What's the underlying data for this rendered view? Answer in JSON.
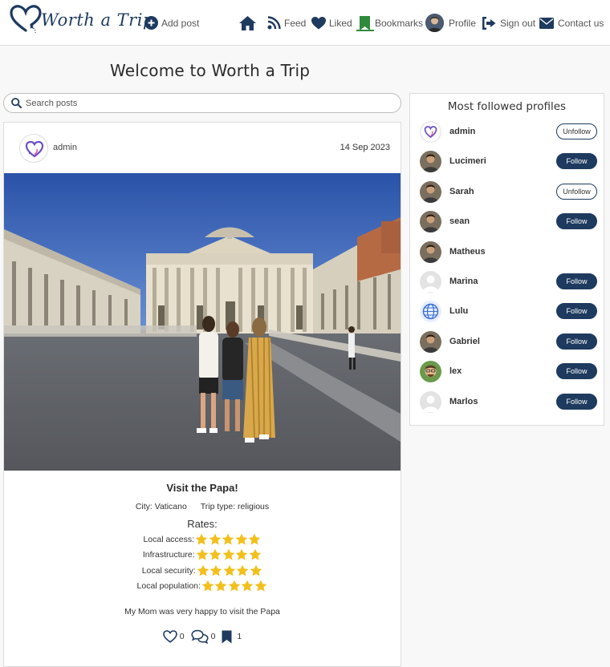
{
  "nav": {
    "logo_text": "Worth a Trip",
    "add_post": "Add post",
    "feed": "Feed",
    "liked": "Liked",
    "bookmarks": "Bookmarks",
    "profile": "Profile",
    "sign_out": "Sign out",
    "contact": "Contact us",
    "brand_color": "#1e3a5f",
    "active_color": "#2f8a3d"
  },
  "page": {
    "title": "Welcome to Worth a Trip"
  },
  "search": {
    "placeholder": "Search posts"
  },
  "post": {
    "owner": "admin",
    "date": "14 Sep 2023",
    "title": "Visit the Papa!",
    "city": "City: Vaticano",
    "trip_type": "Trip type: religious",
    "rates_title": "Rates:",
    "rates": [
      {
        "label": "Local access:",
        "stars": 5
      },
      {
        "label": "Infrastructure:",
        "stars": 5
      },
      {
        "label": "Local security:",
        "stars": 5
      },
      {
        "label": "Local population:",
        "stars": 5
      }
    ],
    "content": "My Mom was very happy to visit the Papa",
    "likes_count": "0",
    "comments_count": "0",
    "bookmarks_count": "1"
  },
  "profiles": {
    "title": "Most followed profiles",
    "items": [
      {
        "name": "admin",
        "button": "Unfollow",
        "avatar": "logo-heart"
      },
      {
        "name": "Lucimeri",
        "button": "Follow",
        "avatar": "photo"
      },
      {
        "name": "Sarah",
        "button": "Unfollow",
        "avatar": "photo"
      },
      {
        "name": "sean",
        "button": "Follow",
        "avatar": "photo"
      },
      {
        "name": "Matheus",
        "button": "",
        "avatar": "photo"
      },
      {
        "name": "Marina",
        "button": "Follow",
        "avatar": "default-user"
      },
      {
        "name": "Lulu",
        "button": "Follow",
        "avatar": "globe"
      },
      {
        "name": "Gabriel",
        "button": "Follow",
        "avatar": "photo"
      },
      {
        "name": "lex",
        "button": "Follow",
        "avatar": "cartoon"
      },
      {
        "name": "Marlos",
        "button": "Follow",
        "avatar": "default-user"
      }
    ]
  }
}
